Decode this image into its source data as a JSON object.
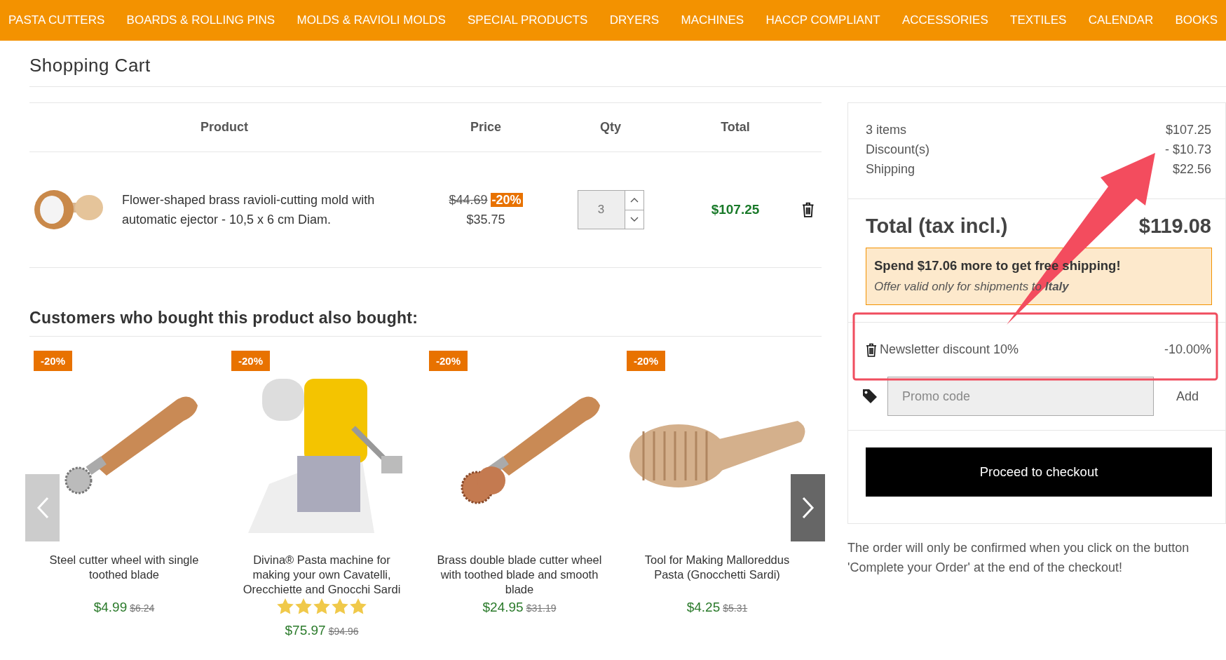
{
  "nav": {
    "items": [
      "PASTA CUTTERS",
      "BOARDS & ROLLING PINS",
      "MOLDS & RAVIOLI MOLDS",
      "SPECIAL PRODUCTS",
      "DRYERS",
      "MACHINES",
      "HACCP COMPLIANT",
      "ACCESSORIES",
      "TEXTILES",
      "CALENDAR",
      "BOOKS"
    ]
  },
  "page_title": "Shopping Cart",
  "cart": {
    "columns": [
      "Product",
      "Price",
      "Qty",
      "Total"
    ],
    "items": [
      {
        "name": "Flower-shaped brass ravioli-cutting mold with automatic ejector - 10,5 x 6 cm Diam.",
        "old_price": "$44.69",
        "discount": "-20%",
        "price": "$35.75",
        "qty": "3",
        "total": "$107.25"
      }
    ]
  },
  "recommendations": {
    "title": "Customers who bought this product also bought:",
    "products": [
      {
        "badge": "-20%",
        "name": "Steel cutter wheel with single toothed blade",
        "price": "$4.99",
        "old_price": "$6.24"
      },
      {
        "badge": "-20%",
        "name": "Divina® Pasta machine for making your own Cavatelli, Orecchiette and Gnocchi Sardi",
        "stars": 5,
        "price": "$75.97",
        "old_price": "$94.96"
      },
      {
        "badge": "-20%",
        "name": "Brass double blade cutter wheel with toothed blade and smooth blade",
        "price": "$24.95",
        "old_price": "$31.19"
      },
      {
        "badge": "-20%",
        "name": "Tool for Making Malloreddus Pasta (Gnocchetti Sardi)",
        "price": "$4.25",
        "old_price": "$5.31"
      }
    ]
  },
  "summary": {
    "lines": [
      {
        "label": "3 items",
        "value": "$107.25"
      },
      {
        "label": "Discount(s)",
        "value": "- $10.73"
      },
      {
        "label": "Shipping",
        "value": "$22.56"
      }
    ],
    "total_label": "Total (tax incl.)",
    "total_value": "$119.08",
    "notice": {
      "title": "Spend $17.06 more to get free shipping!",
      "subtitle": "Offer valid only for shipments to **Italy**"
    },
    "discount": {
      "name": "Newsletter discount 10%",
      "value": "-10.00%"
    },
    "promo": {
      "placeholder": "Promo code",
      "button": "Add"
    },
    "checkout": "Proceed to checkout",
    "note": "The order will only be confirmed when you click on the button 'Complete your Order' at the end of the checkout!"
  }
}
